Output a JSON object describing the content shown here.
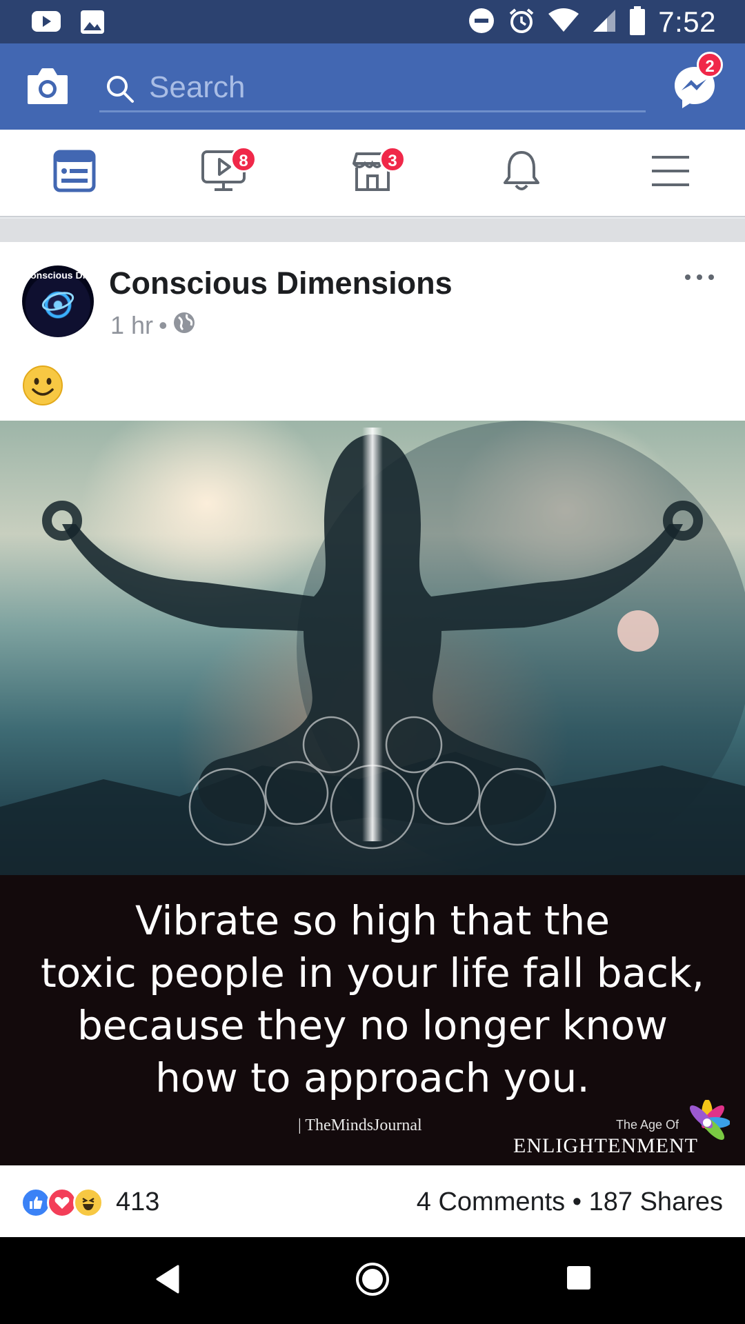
{
  "status_bar": {
    "time": "7:52"
  },
  "search": {
    "placeholder": "Search"
  },
  "messenger": {
    "badge": "2"
  },
  "tabs": [
    {
      "id": "news-feed",
      "badge": ""
    },
    {
      "id": "watch",
      "badge": "8"
    },
    {
      "id": "marketplace",
      "badge": "3"
    },
    {
      "id": "notifications",
      "badge": ""
    },
    {
      "id": "menu",
      "badge": ""
    }
  ],
  "post": {
    "page_name": "Conscious Dimensions",
    "avatar_text": "Conscious Dimensions",
    "time": "1 hr",
    "dot": "•",
    "text_emoji": "🙂",
    "image": {
      "quote_lines": [
        "Vibrate so high that the",
        "toxic people in your life fall back,",
        "because they no longer know",
        "how to approach you."
      ],
      "credit": "| TheMindsJournal",
      "logo_top": "The Age Of",
      "logo_main": "ENLIGHTENMENT"
    },
    "reactions": {
      "count": "413"
    },
    "stats": {
      "comments": "4 Comments",
      "separator": "•",
      "shares": "187 Shares"
    }
  }
}
